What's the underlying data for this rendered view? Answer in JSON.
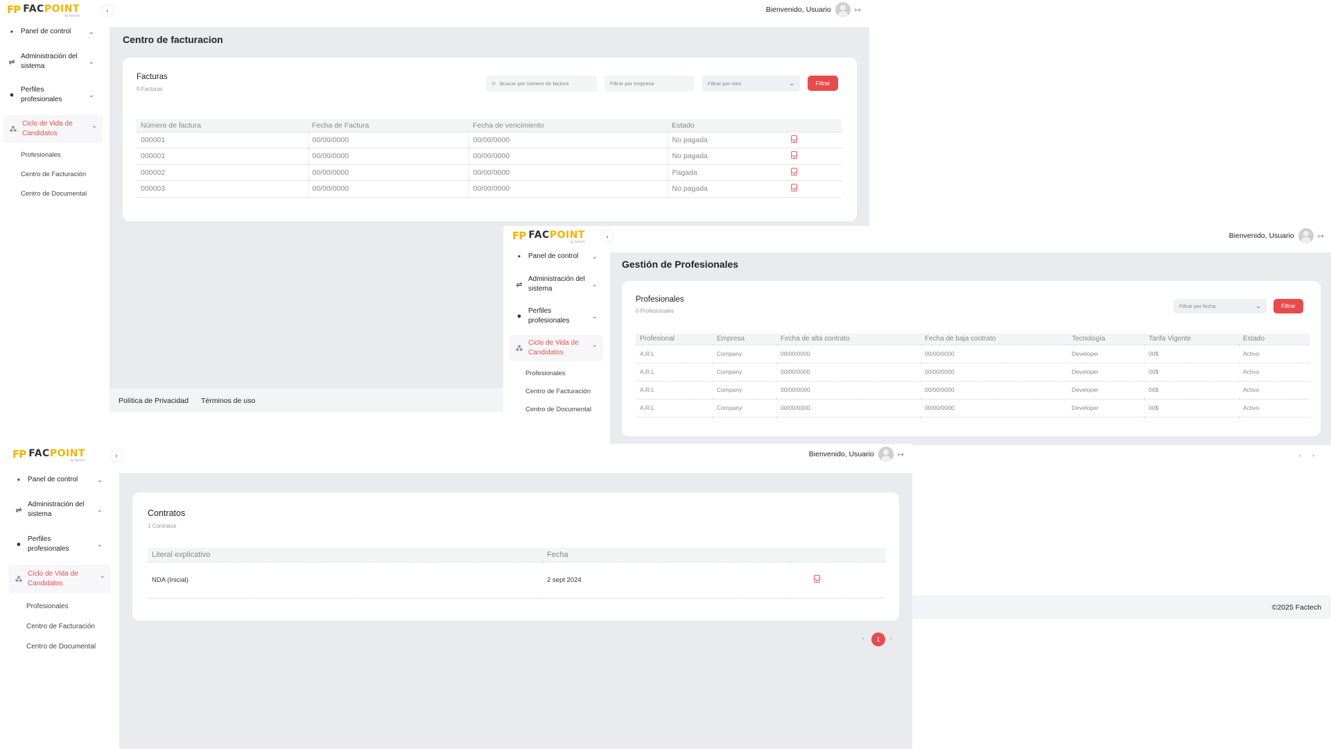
{
  "brand": {
    "logo_mark": "FP",
    "logo_fac": "FAC",
    "logo_point": "POINT",
    "logo_sub": "by Factech"
  },
  "nav": {
    "collapse_icon": "chevron-left",
    "items": [
      {
        "label": "Panel de control",
        "icon": "dashboard-icon"
      },
      {
        "label": "Administración del sistema",
        "icon": "sliders-icon"
      },
      {
        "label": "Perfiles profesionales",
        "icon": "people-icon"
      },
      {
        "label": "Ciclo de Vida de Candidatos",
        "icon": "nodes-icon"
      }
    ],
    "sub_items": [
      "Profesionales",
      "Centro de Facturación",
      "Centro de Documental"
    ]
  },
  "header": {
    "welcome": "Bienvenido, Usuario"
  },
  "billing": {
    "title": "Centro de facturacion",
    "card_title": "Facturas",
    "card_sub": "0 Facturas",
    "search_placeholder": "Buscar por número de factura",
    "company_filter": "Filtrar por empresa",
    "month_filter": "Filtrar por mes",
    "filter_button": "Filtrar",
    "columns": [
      "Número de factura",
      "Fecha de Factura",
      "Fecha de vencimiento",
      "Estado",
      ""
    ],
    "rows": [
      [
        "000001",
        "00/00/0000",
        "00/00/0000",
        "No pagada"
      ],
      [
        "000001",
        "00/00/0000",
        "00/00/0000",
        "No pagada"
      ],
      [
        "000002",
        "00/00/0000",
        "00/00/0000",
        "Pagada"
      ],
      [
        "000003",
        "00/00/0000",
        "00/00/0000",
        "No pagada"
      ]
    ]
  },
  "footer": {
    "privacy": "Política de Privacidad",
    "terms": "Términos de uso",
    "copyright": "©2025 Factech"
  },
  "professionals": {
    "title": "Gestión de Profesionales",
    "card_title": "Profesionales",
    "card_sub": "0 Profesionales",
    "date_filter": "Filtrar por fecha",
    "filter_button": "Filtrar",
    "columns": [
      "Profesional",
      "Empresa",
      "Fecha de alta contrato",
      "Fecha de baja contrato",
      "Tecnología",
      "Tarifa Vigente",
      "Estado"
    ],
    "rows": [
      [
        "A.R.L",
        "Company",
        "00/00/0000",
        "00/00/0000",
        "Developer",
        "00$",
        "Activo"
      ],
      [
        "A.R.L",
        "Company",
        "00/00/0000",
        "00/00/0000",
        "Developer",
        "00$",
        "Activo"
      ],
      [
        "A.R.L",
        "Company",
        "00/00/0000",
        "00/00/0000",
        "Developer",
        "00$",
        "Activo"
      ],
      [
        "A.R.L",
        "Company",
        "00/00/0000",
        "00/00/0000",
        "Developer",
        "00$",
        "Activo"
      ]
    ]
  },
  "contracts": {
    "card_title": "Contratos",
    "card_sub": "1 Contratos",
    "columns": [
      "Literal explicativo",
      "Fecha",
      ""
    ],
    "rows": [
      [
        "NDA (Inicial)",
        "2 sept 2024"
      ]
    ],
    "page": "1",
    "prev_arrow": "‹",
    "next_arrow": "›"
  },
  "colors": {
    "accent": "#e74c4c",
    "brand": "#f1b400",
    "content_bg": "#e9ebee"
  }
}
